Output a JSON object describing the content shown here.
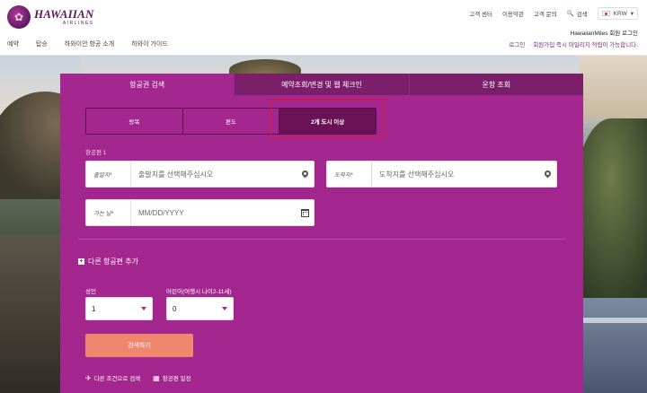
{
  "header": {
    "logo": {
      "name": "HAWAIIAN",
      "sub": "AIRLINES"
    },
    "utility": {
      "customer_center": "고객 센터",
      "terms": "이용약관",
      "inquiry": "고객 문의",
      "search": "검색",
      "currency": "KRW"
    },
    "nav": [
      "예약",
      "탑승",
      "하와이안 항공 소개",
      "하와이 가이드"
    ],
    "member": {
      "miles_login": "HawaiianMiles 회원 로그인",
      "login": "로그인",
      "signup_promo": "· 회원가입 즉시 마일리지 적립이 가능합니다."
    }
  },
  "widget": {
    "tabs": [
      "항공권 검색",
      "예약조회/변경 및 웹 체크인",
      "운항 조회"
    ],
    "active_tab": 0,
    "trip_types": [
      "왕복",
      "편도",
      "2개 도시 이상"
    ],
    "active_trip": 2,
    "segment_label": "항공편 1",
    "origin": {
      "label": "출발지*",
      "placeholder": "출발지를 선택해주십시오"
    },
    "destination": {
      "label": "도착지*",
      "placeholder": "도착지를 선택해주십시오"
    },
    "depart_date": {
      "label": "가는 날*",
      "placeholder": "MM/DD/YYYY"
    },
    "add_flight": "다른 항공편 추가",
    "adults": {
      "label": "성인",
      "value": "1"
    },
    "children": {
      "label": "어린이(여행시 나이2-11세)",
      "value": "0"
    },
    "search_button": "검색하기",
    "links": {
      "other_criteria": "다른 조건으로 검색",
      "schedule": "항공편 일정"
    }
  },
  "colors": {
    "brand_purple": "#a4278f",
    "dark_purple": "#6b1256",
    "search_button": "#f0866e",
    "highlight_red": "#e01a2e"
  }
}
